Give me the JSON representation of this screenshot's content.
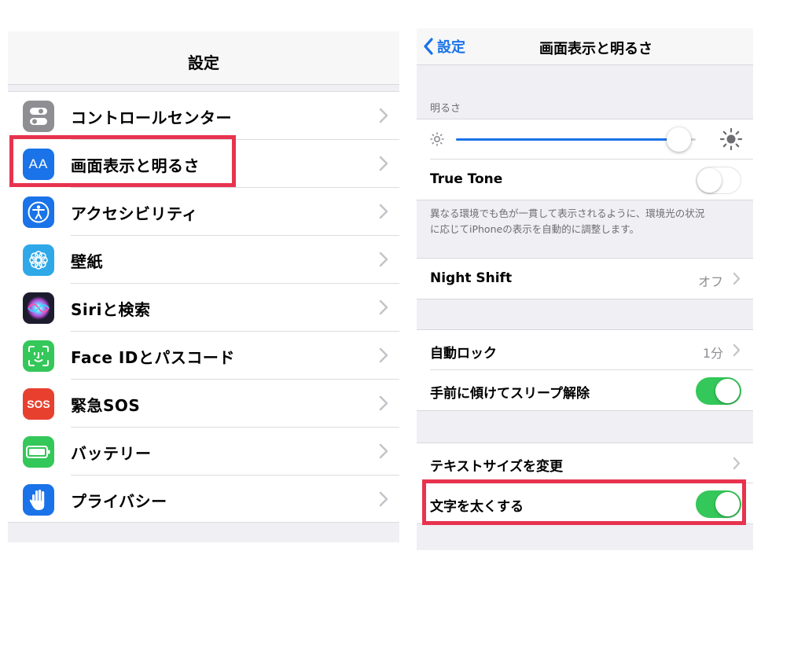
{
  "settings": {
    "title": "設定",
    "items": [
      {
        "label": "コントロールセンター",
        "icon": "toggles-icon",
        "color": "#8e8e93"
      },
      {
        "label": "画面表示と明るさ",
        "icon": "text-size-icon",
        "icon_text": "AA",
        "color": "#1a73e8"
      },
      {
        "label": "アクセシビリティ",
        "icon": "accessibility-icon",
        "color": "#1a73e8"
      },
      {
        "label": "壁紙",
        "icon": "flower-icon",
        "color": "#2fa8e8"
      },
      {
        "label": "Siriと検索",
        "icon": "siri-icon",
        "color": "#1c1c2e"
      },
      {
        "label": "Face IDとパスコード",
        "icon": "face-id-icon",
        "color": "#34c759"
      },
      {
        "label": "緊急SOS",
        "icon": "sos-icon",
        "icon_text": "SOS",
        "color": "#e8402f"
      },
      {
        "label": "バッテリー",
        "icon": "battery-icon",
        "color": "#34c759"
      },
      {
        "label": "プライバシー",
        "icon": "hand-icon",
        "color": "#1a73e8"
      }
    ]
  },
  "display": {
    "back_label": "設定",
    "title": "画面表示と明るさ",
    "brightness_header": "明るさ",
    "brightness_level": 0.93,
    "true_tone": {
      "label": "True Tone",
      "on": false
    },
    "true_tone_note_line1": "異なる環境でも色が一貫して表示されるように、環境光の状況",
    "true_tone_note_line2": "に応じてiPhoneの表示を自動的に調整します。",
    "night_shift": {
      "label": "Night Shift",
      "value": "オフ"
    },
    "auto_lock": {
      "label": "自動ロック",
      "value": "1分"
    },
    "raise_to_wake": {
      "label": "手前に傾けてスリープ解除",
      "on": true
    },
    "text_size": {
      "label": "テキストサイズを変更"
    },
    "bold_text": {
      "label": "文字を太くする",
      "on": true
    }
  },
  "colors": {
    "accent": "#1a73e8",
    "switch_on": "#34c759",
    "highlight": "#e8334f"
  }
}
